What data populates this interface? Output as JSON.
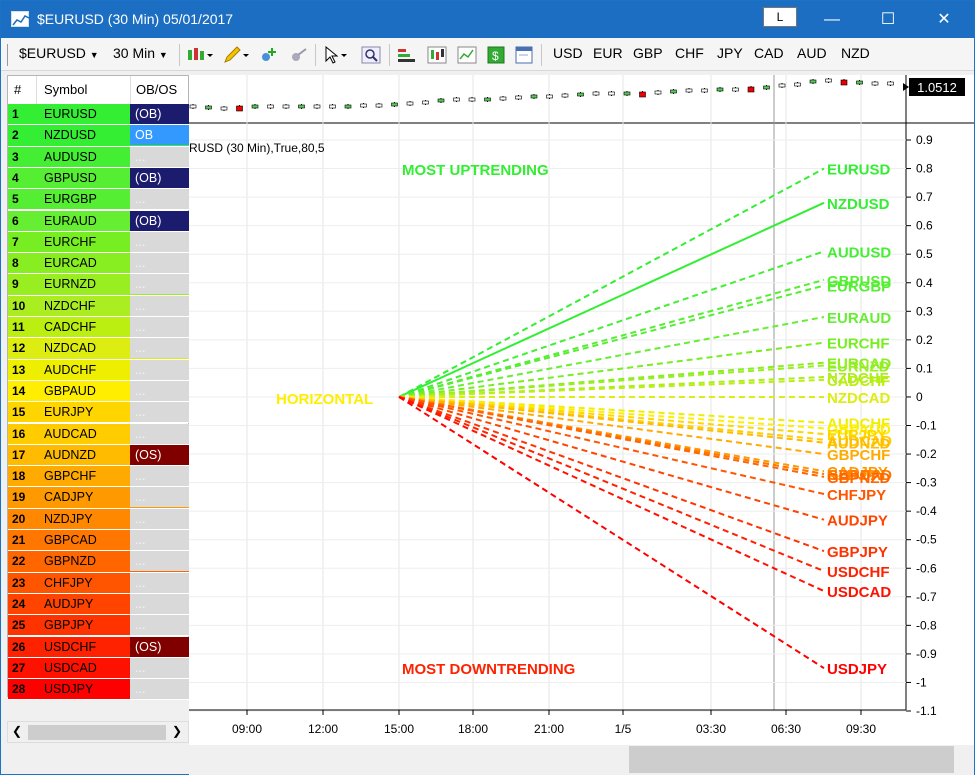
{
  "window": {
    "title": "$EURUSD (30 Min)  05/01/2017",
    "layout_button": "L",
    "minimize": "—",
    "maximize": "☐",
    "close": "✕"
  },
  "toolbar": {
    "symbol": "$EURUSD",
    "timeframe": "30 Min",
    "currencies": [
      "USD",
      "EUR",
      "GBP",
      "CHF",
      "JPY",
      "CAD",
      "AUD",
      "NZD"
    ]
  },
  "table": {
    "headers": [
      "#",
      "Symbol",
      "OB/OS"
    ],
    "rows": [
      {
        "n": "1",
        "sym": "EURUSD",
        "obos": "(OB)",
        "color": "#33ee33",
        "obos_bg": "#1c1c6e",
        "obos_fg": "#ffffff"
      },
      {
        "n": "2",
        "sym": "NZDUSD",
        "obos": "OB",
        "color": "#33ee33",
        "obos_bg": "#3399ff",
        "obos_fg": "#ffffff"
      },
      {
        "n": "3",
        "sym": "AUDUSD",
        "obos": "...",
        "color": "#44ee33",
        "obos_bg": "#d9d9d9",
        "obos_fg": "#f5f5f5"
      },
      {
        "n": "4",
        "sym": "GBPUSD",
        "obos": "(OB)",
        "color": "#55ee33",
        "obos_bg": "#1c1c6e",
        "obos_fg": "#ffffff"
      },
      {
        "n": "5",
        "sym": "EURGBP",
        "obos": "...",
        "color": "#55ee33",
        "obos_bg": "#d9d9d9",
        "obos_fg": "#f5f5f5"
      },
      {
        "n": "6",
        "sym": "EURAUD",
        "obos": "(OB)",
        "color": "#66ee33",
        "obos_bg": "#1c1c6e",
        "obos_fg": "#ffffff"
      },
      {
        "n": "7",
        "sym": "EURCHF",
        "obos": "...",
        "color": "#77ee22",
        "obos_bg": "#d9d9d9",
        "obos_fg": "#f5f5f5"
      },
      {
        "n": "8",
        "sym": "EURCAD",
        "obos": "...",
        "color": "#88ee22",
        "obos_bg": "#d9d9d9",
        "obos_fg": "#f5f5f5"
      },
      {
        "n": "9",
        "sym": "EURNZD",
        "obos": "...",
        "color": "#99ee22",
        "obos_bg": "#d9d9d9",
        "obos_fg": "#f5f5f5"
      },
      {
        "n": "10",
        "sym": "NZDCHF",
        "obos": "...",
        "color": "#aaee22",
        "obos_bg": "#d9d9d9",
        "obos_fg": "#f5f5f5"
      },
      {
        "n": "11",
        "sym": "CADCHF",
        "obos": "...",
        "color": "#bbee11",
        "obos_bg": "#d9d9d9",
        "obos_fg": "#f5f5f5"
      },
      {
        "n": "12",
        "sym": "NZDCAD",
        "obos": "...",
        "color": "#dded11",
        "obos_bg": "#d9d9d9",
        "obos_fg": "#f5f5f5"
      },
      {
        "n": "13",
        "sym": "AUDCHF",
        "obos": "...",
        "color": "#eeee00",
        "obos_bg": "#d9d9d9",
        "obos_fg": "#f5f5f5"
      },
      {
        "n": "14",
        "sym": "GBPAUD",
        "obos": "...",
        "color": "#ffee00",
        "obos_bg": "#d9d9d9",
        "obos_fg": "#f5f5f5"
      },
      {
        "n": "15",
        "sym": "EURJPY",
        "obos": "...",
        "color": "#ffd500",
        "obos_bg": "#d9d9d9",
        "obos_fg": "#f5f5f5"
      },
      {
        "n": "16",
        "sym": "AUDCAD",
        "obos": "...",
        "color": "#ffcc00",
        "obos_bg": "#d9d9d9",
        "obos_fg": "#f5f5f5"
      },
      {
        "n": "17",
        "sym": "AUDNZD",
        "obos": "(OS)",
        "color": "#ffbb00",
        "obos_bg": "#800000",
        "obos_fg": "#ffffff"
      },
      {
        "n": "18",
        "sym": "GBPCHF",
        "obos": "...",
        "color": "#ffaa00",
        "obos_bg": "#d9d9d9",
        "obos_fg": "#f5f5f5"
      },
      {
        "n": "19",
        "sym": "CADJPY",
        "obos": "...",
        "color": "#ff9900",
        "obos_bg": "#d9d9d9",
        "obos_fg": "#f5f5f5"
      },
      {
        "n": "20",
        "sym": "NZDJPY",
        "obos": "...",
        "color": "#ff8800",
        "obos_bg": "#d9d9d9",
        "obos_fg": "#f5f5f5"
      },
      {
        "n": "21",
        "sym": "GBPCAD",
        "obos": "...",
        "color": "#ff7700",
        "obos_bg": "#d9d9d9",
        "obos_fg": "#f5f5f5"
      },
      {
        "n": "22",
        "sym": "GBPNZD",
        "obos": "...",
        "color": "#ff6600",
        "obos_bg": "#d9d9d9",
        "obos_fg": "#f5f5f5"
      },
      {
        "n": "23",
        "sym": "CHFJPY",
        "obos": "...",
        "color": "#ff5500",
        "obos_bg": "#d9d9d9",
        "obos_fg": "#f5f5f5"
      },
      {
        "n": "24",
        "sym": "AUDJPY",
        "obos": "...",
        "color": "#ff4400",
        "obos_bg": "#d9d9d9",
        "obos_fg": "#f5f5f5"
      },
      {
        "n": "25",
        "sym": "GBPJPY",
        "obos": "...",
        "color": "#ff3300",
        "obos_bg": "#d9d9d9",
        "obos_fg": "#f5f5f5"
      },
      {
        "n": "26",
        "sym": "USDCHF",
        "obos": "(OS)",
        "color": "#ff2200",
        "obos_bg": "#800000",
        "obos_fg": "#ffffff"
      },
      {
        "n": "27",
        "sym": "USDCAD",
        "obos": "...",
        "color": "#ff1100",
        "obos_bg": "#d9d9d9",
        "obos_fg": "#f5f5f5"
      },
      {
        "n": "28",
        "sym": "USDJPY",
        "obos": "...",
        "color": "#ff0000",
        "obos_bg": "#d9d9d9",
        "obos_fg": "#f5f5f5"
      }
    ]
  },
  "chart_data": {
    "type": "line",
    "price_label": "1.0512",
    "indicator_label": "RUSD (30 Min),True,80,5",
    "x_ticks": [
      "09:00",
      "12:00",
      "15:00",
      "18:00",
      "21:00",
      "1/5",
      "03:30",
      "06:30",
      "09:30"
    ],
    "y_ticks": [
      "0.9",
      "0.8",
      "0.7",
      "0.6",
      "0.5",
      "0.4",
      "0.3",
      "0.2",
      "0.1",
      "0",
      "-0.1",
      "-0.2",
      "-0.3",
      "-0.4",
      "-0.5",
      "-0.6",
      "-0.7",
      "-0.8",
      "-0.9",
      "-1",
      "-1.1"
    ],
    "ylim": [
      -1.1,
      0.9
    ],
    "annotations": {
      "top": "MOST UPTRENDING",
      "center": "HORIZONTAL",
      "bottom": "MOST DOWNTRENDING"
    },
    "series": [
      {
        "name": "EURUSD",
        "value": 0.8,
        "color": "#33ee33",
        "solid": false
      },
      {
        "name": "NZDUSD",
        "value": 0.68,
        "color": "#33ee33",
        "solid": true
      },
      {
        "name": "AUDUSD",
        "value": 0.51,
        "color": "#44ee33",
        "solid": false
      },
      {
        "name": "GBPUSD",
        "value": 0.41,
        "color": "#55ee33",
        "solid": false
      },
      {
        "name": "EURGBP",
        "value": 0.39,
        "color": "#55ee33",
        "solid": false
      },
      {
        "name": "EURAUD",
        "value": 0.28,
        "color": "#66ee33",
        "solid": false
      },
      {
        "name": "EURCHF",
        "value": 0.19,
        "color": "#77ee22",
        "solid": false
      },
      {
        "name": "EURCAD",
        "value": 0.12,
        "color": "#88ee22",
        "solid": false
      },
      {
        "name": "EURNZD",
        "value": 0.11,
        "color": "#99ee22",
        "solid": false
      },
      {
        "name": "NZDCHF",
        "value": 0.07,
        "color": "#aaee22",
        "solid": false
      },
      {
        "name": "CADCHF",
        "value": 0.06,
        "color": "#bbee11",
        "solid": false
      },
      {
        "name": "NZDCAD",
        "value": 0.0,
        "color": "#dded11",
        "solid": false
      },
      {
        "name": "AUDCHF",
        "value": -0.09,
        "color": "#eeee00",
        "solid": false
      },
      {
        "name": "GBPAUD",
        "value": -0.11,
        "color": "#ffee00",
        "solid": false
      },
      {
        "name": "EURJPY",
        "value": -0.13,
        "color": "#ffd500",
        "solid": false
      },
      {
        "name": "AUDCAD",
        "value": -0.15,
        "color": "#ffcc00",
        "solid": false
      },
      {
        "name": "AUDNZD",
        "value": -0.16,
        "color": "#ffbb00",
        "solid": false
      },
      {
        "name": "GBPCHF",
        "value": -0.2,
        "color": "#ffaa00",
        "solid": false
      },
      {
        "name": "CADJPY",
        "value": -0.26,
        "color": "#ff9900",
        "solid": false
      },
      {
        "name": "NZDJPY",
        "value": -0.27,
        "color": "#ff8800",
        "solid": false
      },
      {
        "name": "GBPCAD",
        "value": -0.27,
        "color": "#ff7700",
        "solid": false
      },
      {
        "name": "GBPNZD",
        "value": -0.28,
        "color": "#ff6600",
        "solid": false
      },
      {
        "name": "CHFJPY",
        "value": -0.34,
        "color": "#ff5500",
        "solid": false
      },
      {
        "name": "AUDJPY",
        "value": -0.43,
        "color": "#ff4400",
        "solid": false
      },
      {
        "name": "GBPJPY",
        "value": -0.54,
        "color": "#ff3300",
        "solid": false
      },
      {
        "name": "USDCHF",
        "value": -0.61,
        "color": "#ff2200",
        "solid": false
      },
      {
        "name": "USDCAD",
        "value": -0.68,
        "color": "#ff1100",
        "solid": false
      },
      {
        "name": "USDJPY",
        "value": -0.95,
        "color": "#ff0000",
        "solid": false
      }
    ]
  }
}
